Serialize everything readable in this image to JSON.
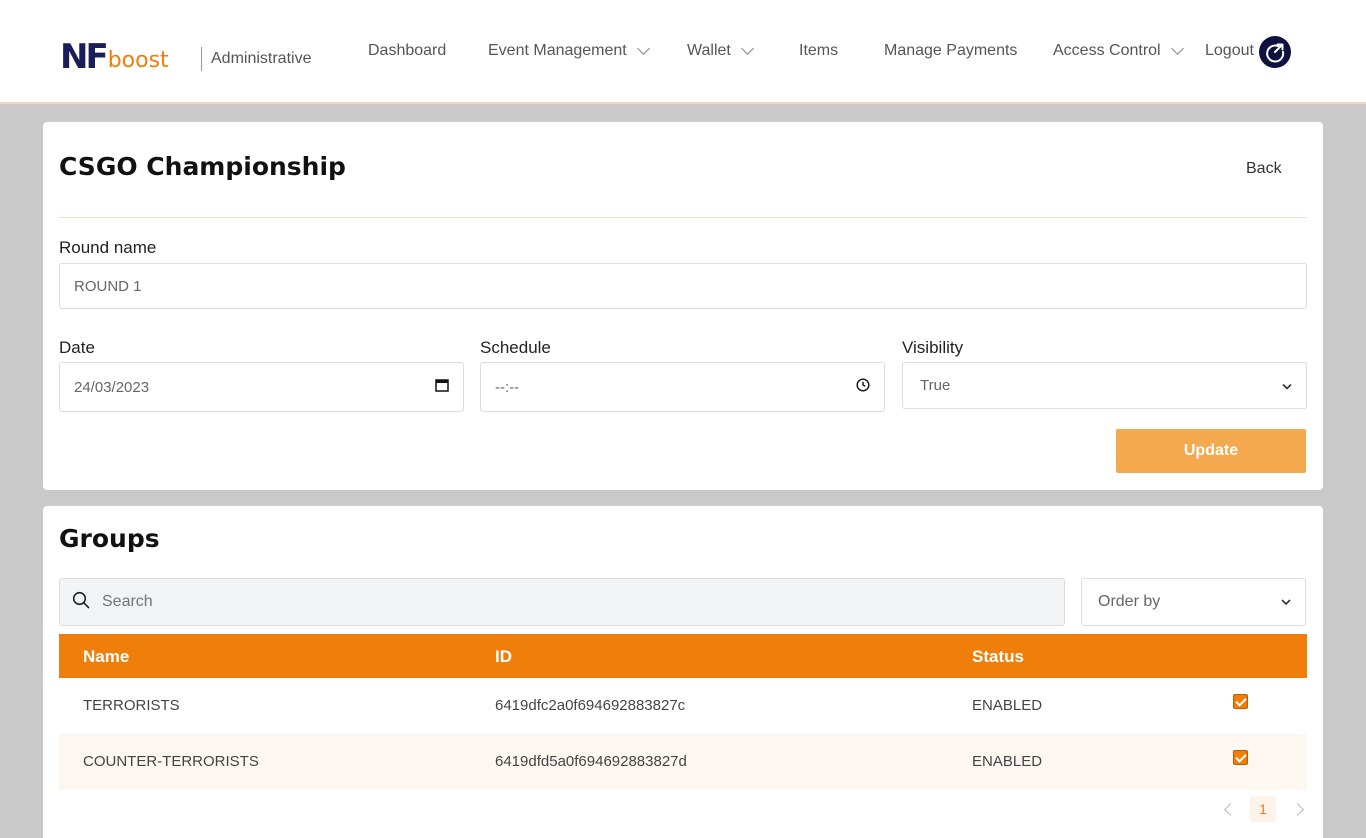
{
  "header": {
    "logo_main": "NF",
    "logo_accent": "boost",
    "subtitle": "Administrative",
    "nav": [
      {
        "label": "Dashboard",
        "has_dropdown": false
      },
      {
        "label": "Event Management",
        "has_dropdown": true
      },
      {
        "label": "Wallet",
        "has_dropdown": true
      },
      {
        "label": "Items",
        "has_dropdown": false
      },
      {
        "label": "Manage Payments",
        "has_dropdown": false
      },
      {
        "label": "Access Control",
        "has_dropdown": true
      },
      {
        "label": "Logout",
        "has_dropdown": false
      }
    ],
    "logout_icon": "logout-icon"
  },
  "round": {
    "page_title": "CSGO Championship",
    "back_label": "Back",
    "round_name_label": "Round name",
    "round_name_value": "ROUND 1",
    "date_label": "Date",
    "date_value": "24/03/2023",
    "schedule_label": "Schedule",
    "schedule_value": "--:--",
    "visibility_label": "Visibility",
    "visibility_value": "True",
    "update_label": "Update"
  },
  "groups": {
    "title": "Groups",
    "search_placeholder": "Search",
    "order_by_value": "Order by",
    "columns": [
      "Name",
      "ID",
      "Status"
    ],
    "rows": [
      {
        "name": "TERRORISTS",
        "id": "6419dfc2a0f694692883827c",
        "status": "ENABLED",
        "checked": true
      },
      {
        "name": "COUNTER-TERRORISTS",
        "id": "6419dfd5a0f694692883827d",
        "status": "ENABLED",
        "checked": true
      }
    ],
    "current_page": "1"
  },
  "colors": {
    "accent": "#ef7f0a",
    "button": "#f5a94e",
    "brand_navy": "#1a1f5c"
  }
}
